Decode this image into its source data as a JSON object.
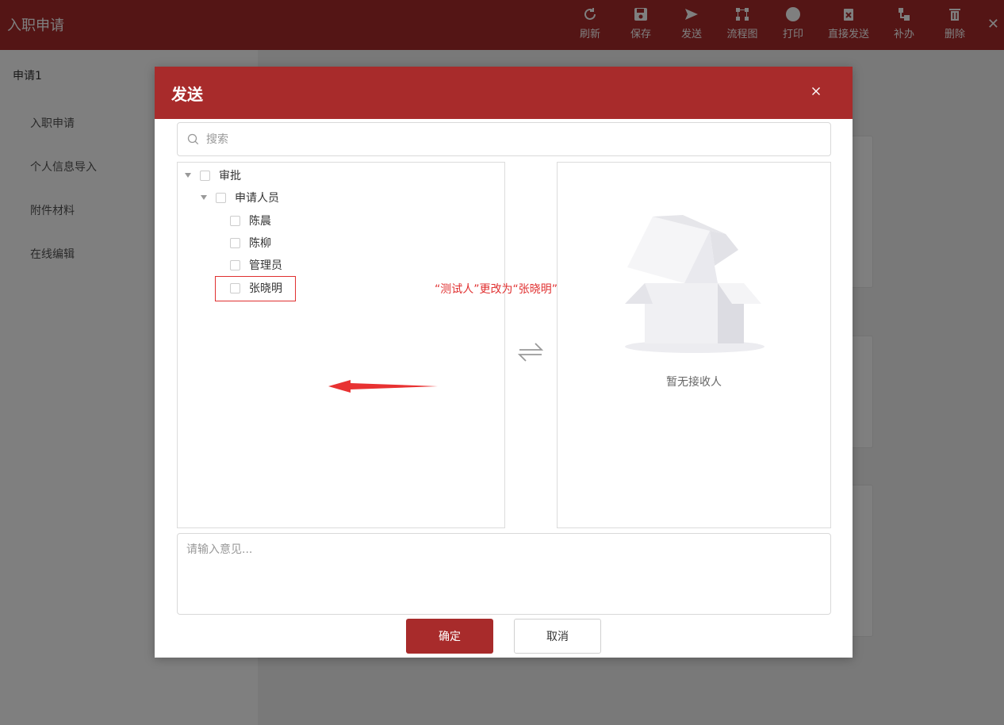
{
  "app": {
    "title": "入职申请"
  },
  "toolbar": [
    {
      "label": "刷新",
      "icon": "refresh-icon"
    },
    {
      "label": "保存",
      "icon": "save-icon"
    },
    {
      "label": "发送",
      "icon": "send-icon"
    },
    {
      "label": "流程图",
      "icon": "flowchart-icon"
    },
    {
      "label": "打印",
      "icon": "print-icon"
    },
    {
      "label": "直接发送",
      "icon": "direct-send-icon"
    },
    {
      "label": "补办",
      "icon": "supplement-icon"
    },
    {
      "label": "删除",
      "icon": "delete-icon"
    }
  ],
  "sidebar": {
    "header": "申请1",
    "items": [
      "入职申请",
      "个人信息导入",
      "附件材料",
      "在线编辑"
    ]
  },
  "dialog": {
    "title": "发送",
    "search_placeholder": "搜索",
    "tree": {
      "root": "审批",
      "group": "申请人员",
      "members": [
        "陈晨",
        "陈柳",
        "管理员",
        "张晓明"
      ]
    },
    "empty_text": "暂无接收人",
    "annotation": "“测试人”更改为“张晓明”",
    "opinion_placeholder": "请输入意见...",
    "ok_label": "确定",
    "cancel_label": "取消"
  },
  "colors": {
    "brand": "#a82b2b",
    "annotation": "#e03030"
  }
}
